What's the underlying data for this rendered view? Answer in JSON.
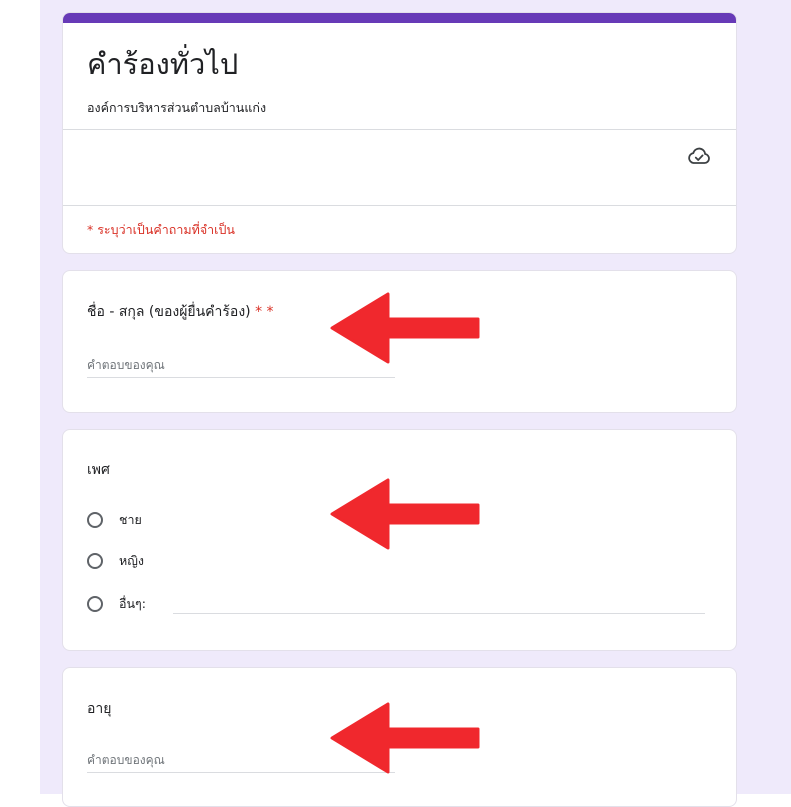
{
  "form": {
    "title": "คำร้องทั่วไป",
    "subtitle": "องค์การบริหารส่วนตำบลบ้านแก่ง",
    "required_note": "* ระบุว่าเป็นคำถามที่จำเป็น"
  },
  "questions": [
    {
      "title": "ชื่อ - สกุล (ของผู้ยื่นคำร้อง)",
      "required_marks": "* *",
      "placeholder": "คำตอบของคุณ"
    },
    {
      "title": "เพศ",
      "options": [
        "ชาย",
        "หญิง",
        "อื่นๆ:"
      ]
    },
    {
      "title": "อายุ",
      "placeholder": "คำตอบของคุณ"
    }
  ],
  "icons": {
    "save_status": "cloud-check-icon",
    "annotation_arrow": "left-arrow-icon"
  },
  "colors": {
    "accent": "#673ab7",
    "page_background": "#efeafb",
    "required": "#d93025",
    "annotation_arrow": "#f0282d"
  }
}
